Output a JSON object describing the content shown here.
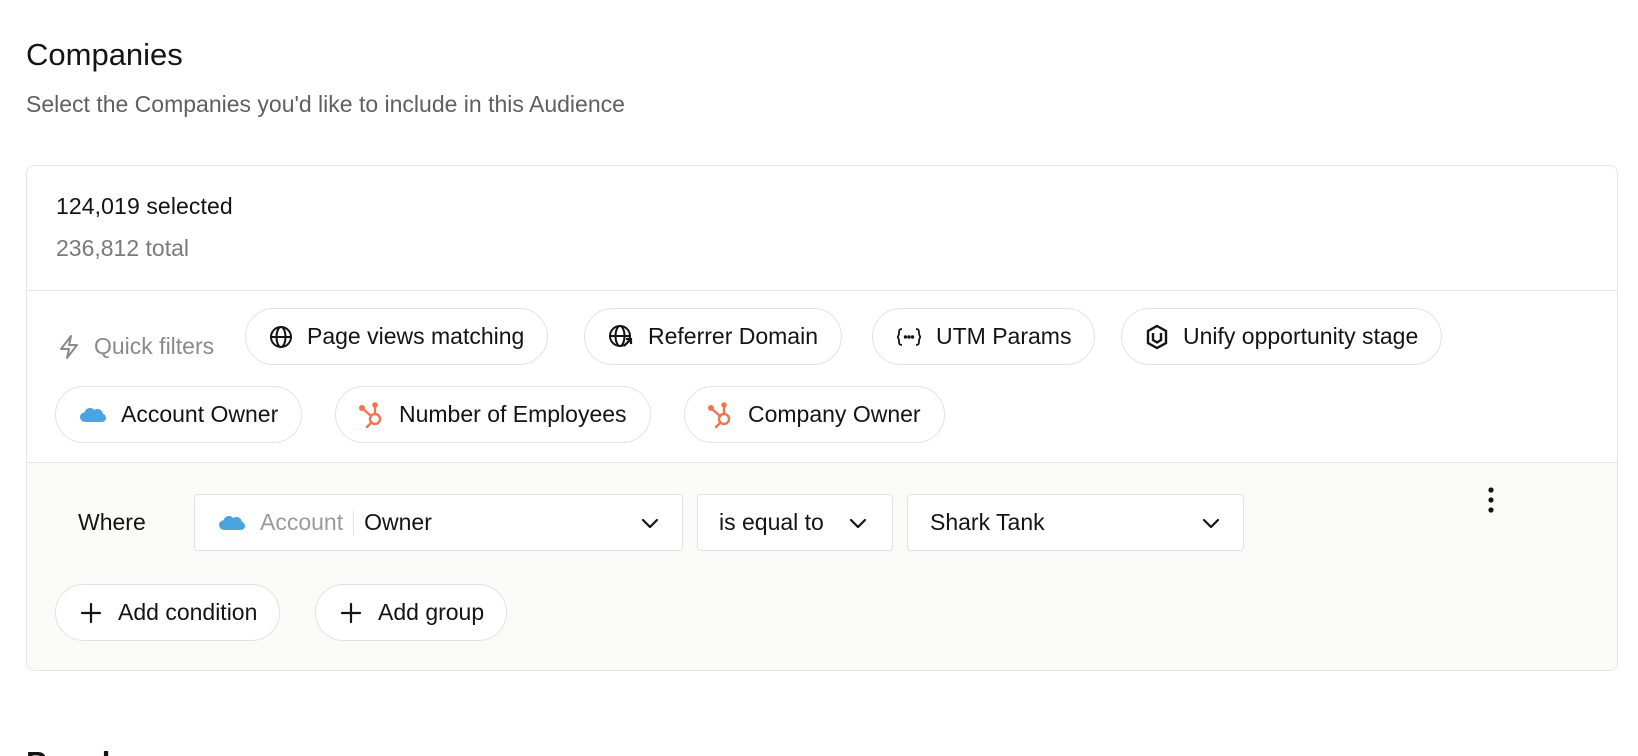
{
  "header": {
    "title": "Companies",
    "subtitle": "Select the Companies you'd like to include in this Audience"
  },
  "summary": {
    "selected": "124,019 selected",
    "total": "236,812 total"
  },
  "quick_filters": {
    "label": "Quick filters",
    "chips": [
      {
        "label": "Page views matching",
        "icon": "globe-icon"
      },
      {
        "label": "Referrer Domain",
        "icon": "globe-arrow-icon"
      },
      {
        "label": "UTM Params",
        "icon": "braces-icon"
      },
      {
        "label": "Unify opportunity stage",
        "icon": "unify-logo-icon"
      },
      {
        "label": "Account Owner",
        "icon": "salesforce-cloud-icon"
      },
      {
        "label": "Number of Employees",
        "icon": "hubspot-icon"
      },
      {
        "label": "Company Owner",
        "icon": "hubspot-icon"
      }
    ]
  },
  "condition": {
    "where_label": "Where",
    "field_object": "Account",
    "field_name": "Owner",
    "operator": "is equal to",
    "value": "Shark Tank"
  },
  "actions": {
    "add_condition": "Add condition",
    "add_group": "Add group"
  },
  "next_section": {
    "title": "People"
  },
  "colors": {
    "salesforce": "#4ba3e0",
    "hubspot": "#f0754d",
    "border": "#e2e2e2",
    "muted_text": "#7a7a7a",
    "condition_bg": "#fafaf9"
  }
}
